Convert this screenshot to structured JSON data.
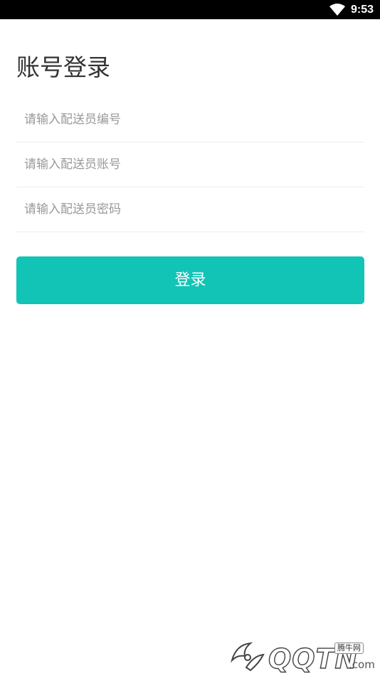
{
  "status_bar": {
    "time": "9:53",
    "wifi_icon": "wifi-icon"
  },
  "login": {
    "title": "账号登录",
    "fields": [
      {
        "placeholder": "请输入配送员编号",
        "value": ""
      },
      {
        "placeholder": "请输入配送员账号",
        "value": ""
      },
      {
        "placeholder": "请输入配送员密码",
        "value": ""
      }
    ],
    "submit_label": "登录"
  },
  "watermark": {
    "text": "QQTN",
    "suffix": ".com",
    "badge": "腾牛网"
  },
  "colors": {
    "accent": "#12c4b5",
    "title_text": "#333333",
    "placeholder": "#999999",
    "divider": "#eeeeee",
    "status_bar": "#000000"
  }
}
